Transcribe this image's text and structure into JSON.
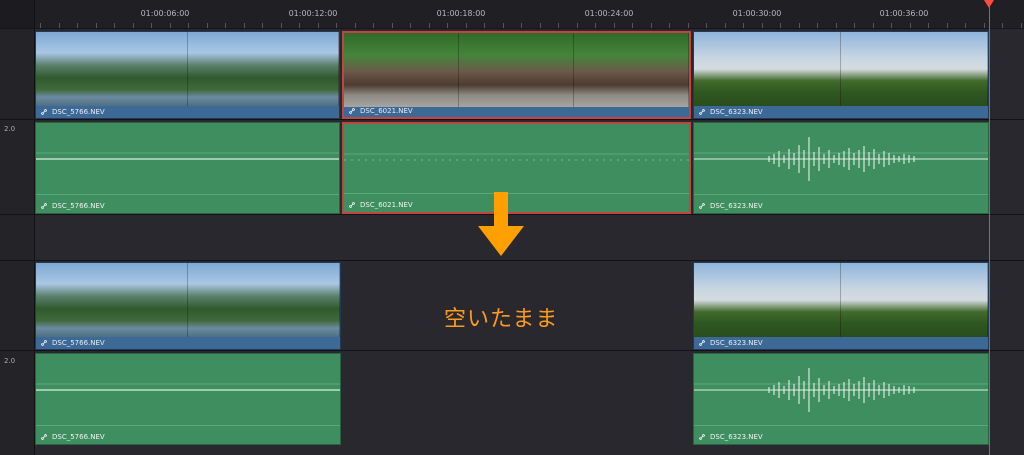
{
  "timeline": {
    "timecodes": [
      "01:00:06:00",
      "01:00:12:00",
      "01:00:18:00",
      "01:00:24:00",
      "01:00:30:00",
      "01:00:36:00"
    ],
    "audio_levels": [
      "2.0",
      "2.0"
    ]
  },
  "before": {
    "video_clips": [
      {
        "name": "DSC_5766.NEV",
        "scene": "mountain-river",
        "selected": false
      },
      {
        "name": "DSC_6021.NEV",
        "scene": "tent",
        "selected": true
      },
      {
        "name": "DSC_6323.NEV",
        "scene": "sky-hill",
        "selected": false
      }
    ],
    "audio_clips": [
      {
        "name": "DSC_5766.NEV",
        "selected": false
      },
      {
        "name": "DSC_6021.NEV",
        "selected": true
      },
      {
        "name": "DSC_6323.NEV",
        "selected": false
      }
    ]
  },
  "after": {
    "video_clips": [
      {
        "name": "DSC_5766.NEV"
      },
      {
        "name": "DSC_6323.NEV"
      }
    ],
    "audio_clips": [
      {
        "name": "DSC_5766.NEV"
      },
      {
        "name": "DSC_6323.NEV"
      }
    ]
  },
  "annotation": {
    "message": "空いたまま",
    "arrow_color": "#ffa000",
    "message_color": "#ff9b1a"
  },
  "colors": {
    "video_clip": "#3d6997",
    "audio_clip": "#3e8e5f",
    "selection": "#c4453f",
    "playhead": "#e8433a"
  },
  "icons": {
    "clip_link": "link-icon",
    "playhead": "playhead-marker-icon",
    "down_arrow": "down-arrow-icon"
  }
}
